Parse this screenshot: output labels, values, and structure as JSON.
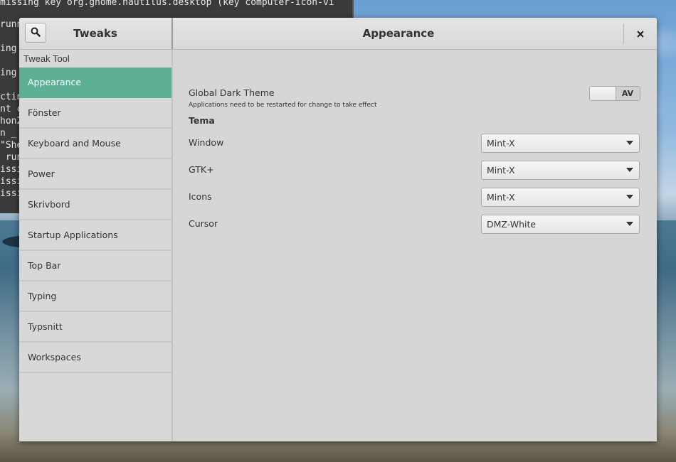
{
  "terminal": {
    "lines": [
      "missing key org.gnome.nautilus.desktop (key computer-icon-vi",
      "runn",
      "ing",
      "ing",
      "ctin",
      "nt c",
      "hon2",
      "n _",
      "\"She",
      " run",
      "issi",
      "issi",
      "issi"
    ]
  },
  "window": {
    "app_title": "Tweaks",
    "page_title": "Appearance",
    "search_icon": "search-icon",
    "close_icon": "close-icon"
  },
  "sidebar": {
    "header": "Tweak Tool",
    "items": [
      {
        "label": "Appearance",
        "selected": true
      },
      {
        "label": "Fönster",
        "selected": false
      },
      {
        "label": "Keyboard and Mouse",
        "selected": false
      },
      {
        "label": "Power",
        "selected": false
      },
      {
        "label": "Skrivbord",
        "selected": false
      },
      {
        "label": "Startup Applications",
        "selected": false
      },
      {
        "label": "Top Bar",
        "selected": false
      },
      {
        "label": "Typing",
        "selected": false
      },
      {
        "label": "Typsnitt",
        "selected": false
      },
      {
        "label": "Workspaces",
        "selected": false
      }
    ]
  },
  "appearance": {
    "dark_theme": {
      "label": "Global Dark Theme",
      "note": "Applications need to be restarted for change to take effect",
      "switch_state": "AV"
    },
    "section_title": "Tema",
    "themes": [
      {
        "label": "Window",
        "value": "Mint-X"
      },
      {
        "label": "GTK+",
        "value": "Mint-X"
      },
      {
        "label": "Icons",
        "value": "Mint-X"
      },
      {
        "label": "Cursor",
        "value": "DMZ-White"
      }
    ]
  },
  "colors": {
    "accent": "#5daf96",
    "window_bg": "#d6d6d6"
  }
}
